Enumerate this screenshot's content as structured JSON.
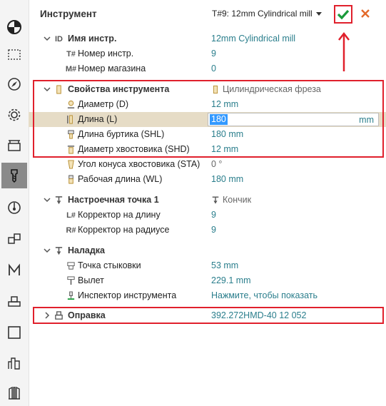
{
  "sidebar": {
    "items": [
      {
        "icon": "disc-icon"
      },
      {
        "icon": "dashed-square-icon"
      },
      {
        "icon": "compass-icon"
      },
      {
        "icon": "gear-icon"
      },
      {
        "icon": "fixture-icon"
      },
      {
        "icon": "tool-icon",
        "active": true
      },
      {
        "icon": "probe-icon"
      },
      {
        "icon": "blocks-icon"
      },
      {
        "icon": "m-letter-icon"
      },
      {
        "icon": "stand-icon"
      },
      {
        "icon": "square-icon"
      },
      {
        "icon": "buildings-icon"
      },
      {
        "icon": "columns-icon"
      }
    ]
  },
  "header": {
    "title": "Инструмент",
    "tool_selector": "T#9: 12mm Cylindrical mill"
  },
  "general": {
    "name_label": "Имя инстр.",
    "name_prefix": "ID",
    "name_value": "12mm Cylindrical mill",
    "number_label": "Номер инстр.",
    "number_prefix": "T#",
    "number_value": "9",
    "magazine_label": "Номер магазина",
    "magazine_prefix": "M#",
    "magazine_value": "0"
  },
  "tool_props": {
    "label": "Свойства инструмента",
    "value": "Цилиндрическая фреза",
    "diameter_label": "Диаметр (D)",
    "diameter_value": "12 mm",
    "length_label": "Длина (L)",
    "length_value": "180",
    "length_unit": "mm",
    "collar_label": "Длина буртика (SHL)",
    "collar_value": "180 mm",
    "shank_label": "Диаметр хвостовика (SHD)",
    "shank_value": "12 mm",
    "taper_label": "Угол конуса хвостовика (STA)",
    "taper_value": "0 °",
    "working_label": "Рабочая длина (WL)",
    "working_value": "180 mm"
  },
  "setup_point": {
    "label": "Настроечная точка 1",
    "value": "Кончик",
    "length_corr_label": "Корректор на длину",
    "length_corr_prefix": "L#",
    "length_corr_value": "9",
    "radius_corr_label": "Корректор на радиусе",
    "radius_corr_prefix": "R#",
    "radius_corr_value": "9"
  },
  "setup": {
    "label": "Наладка",
    "dock_label": "Точка стыковки",
    "dock_value": "53 mm",
    "overhang_label": "Вылет",
    "overhang_value": "229.1 mm",
    "inspector_label": "Инспектор инструмента",
    "inspector_value": "Нажмите, чтобы показать"
  },
  "holder": {
    "label": "Оправка",
    "value": "392.272HMD-40 12 052"
  },
  "colors": {
    "accent": "#2a7e8c",
    "highlight": "#e0202c",
    "selection": "#3399ff",
    "ok": "#1a9a3a"
  }
}
